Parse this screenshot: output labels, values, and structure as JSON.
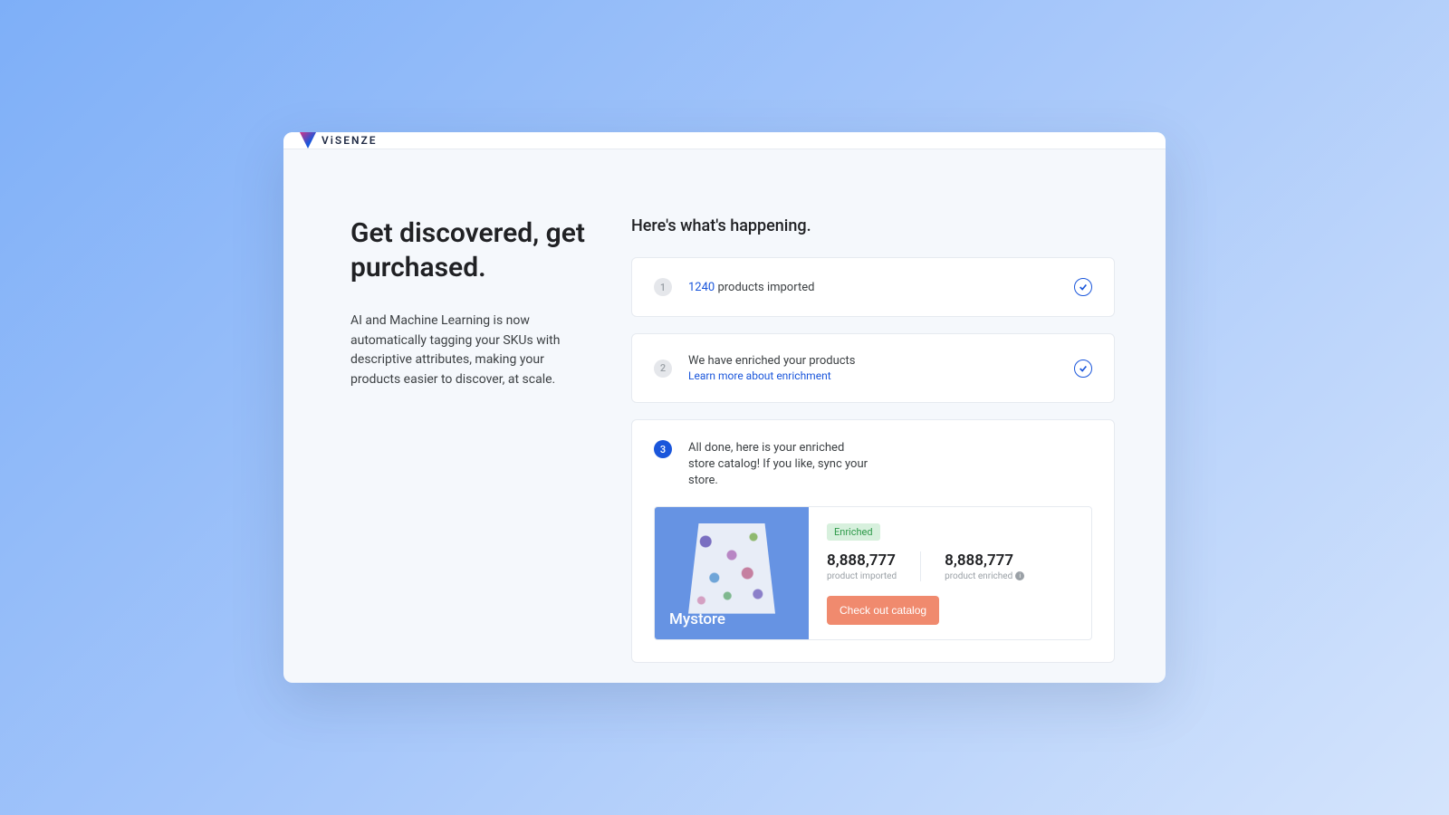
{
  "brand": {
    "name": "ViSENZE"
  },
  "hero": {
    "title": "Get discovered, get purchased.",
    "body": "AI and Machine Learning is now automatically tagging your SKUs with descriptive attributes, making your products easier to discover, at scale."
  },
  "right_title": "Here's what's happening.",
  "step1": {
    "num": "1",
    "count": "1240",
    "suffix": " products imported"
  },
  "step2": {
    "num": "2",
    "text": "We have enriched your products",
    "link": "Learn more about enrichment"
  },
  "step3": {
    "num": "3",
    "text": "All done, here is your enriched store catalog! If you like, sync your store."
  },
  "store": {
    "name": "Mystore",
    "badge": "Enriched",
    "stats": [
      {
        "value": "8,888,777",
        "label": "product imported"
      },
      {
        "value": "8,888,777",
        "label": "product enriched"
      }
    ],
    "cta": "Check out catalog"
  },
  "colors": {
    "accent": "#1a56db",
    "cta": "#f08a6e",
    "badge": "#d7f0dd"
  }
}
